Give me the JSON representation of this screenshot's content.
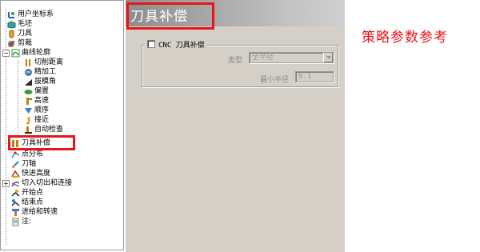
{
  "tree": {
    "items": [
      {
        "label": "用户坐标系",
        "icon": "user-coordinate-icon"
      },
      {
        "label": "毛坯",
        "icon": "stock-block-icon"
      },
      {
        "label": "刀具",
        "icon": "tool-icon"
      },
      {
        "label": "剪裁",
        "icon": "trim-icon"
      },
      {
        "label": "曲线轮廓",
        "icon": "curve-profile-icon",
        "expanded": true
      },
      {
        "label": "切削距离",
        "icon": "cut-distance-icon"
      },
      {
        "label": "精加工",
        "icon": "finishing-icon"
      },
      {
        "label": "拔模角",
        "icon": "draft-angle-icon"
      },
      {
        "label": "偏置",
        "icon": "offset-icon"
      },
      {
        "label": "高速",
        "icon": "high-speed-icon"
      },
      {
        "label": "顺序",
        "icon": "order-icon"
      },
      {
        "label": "接近",
        "icon": "approach-icon"
      },
      {
        "label": "自动检查",
        "icon": "auto-check-icon"
      },
      {
        "label": "刀具补偿",
        "icon": "tool-compensation-icon",
        "selected": true
      },
      {
        "label": "点分布",
        "icon": "point-distribution-icon"
      },
      {
        "label": "刀轴",
        "icon": "tool-axis-icon"
      },
      {
        "label": "快进高度",
        "icon": "rapid-height-icon"
      },
      {
        "label": "切入切出和连接",
        "icon": "leads-links-icon",
        "collapsed": true
      },
      {
        "label": "开始点",
        "icon": "start-point-icon"
      },
      {
        "label": "结束点",
        "icon": "end-point-icon"
      },
      {
        "label": "进给和转速",
        "icon": "feed-speed-icon"
      },
      {
        "label": "注:",
        "icon": "notes-icon"
      }
    ]
  },
  "panel": {
    "title": "刀具补偿",
    "cnc_checkbox_label": "CNC 刀具补偿",
    "cnc_checked": false,
    "type_label": "类型",
    "type_value": "全半径",
    "min_radius_label": "最小半径",
    "min_radius_value": "0.1"
  },
  "annotation": {
    "text": "策略参数参考",
    "color": "#e8151a"
  },
  "colors": {
    "highlight": "#e8151a",
    "panel_bg": "#d4d0c8"
  }
}
